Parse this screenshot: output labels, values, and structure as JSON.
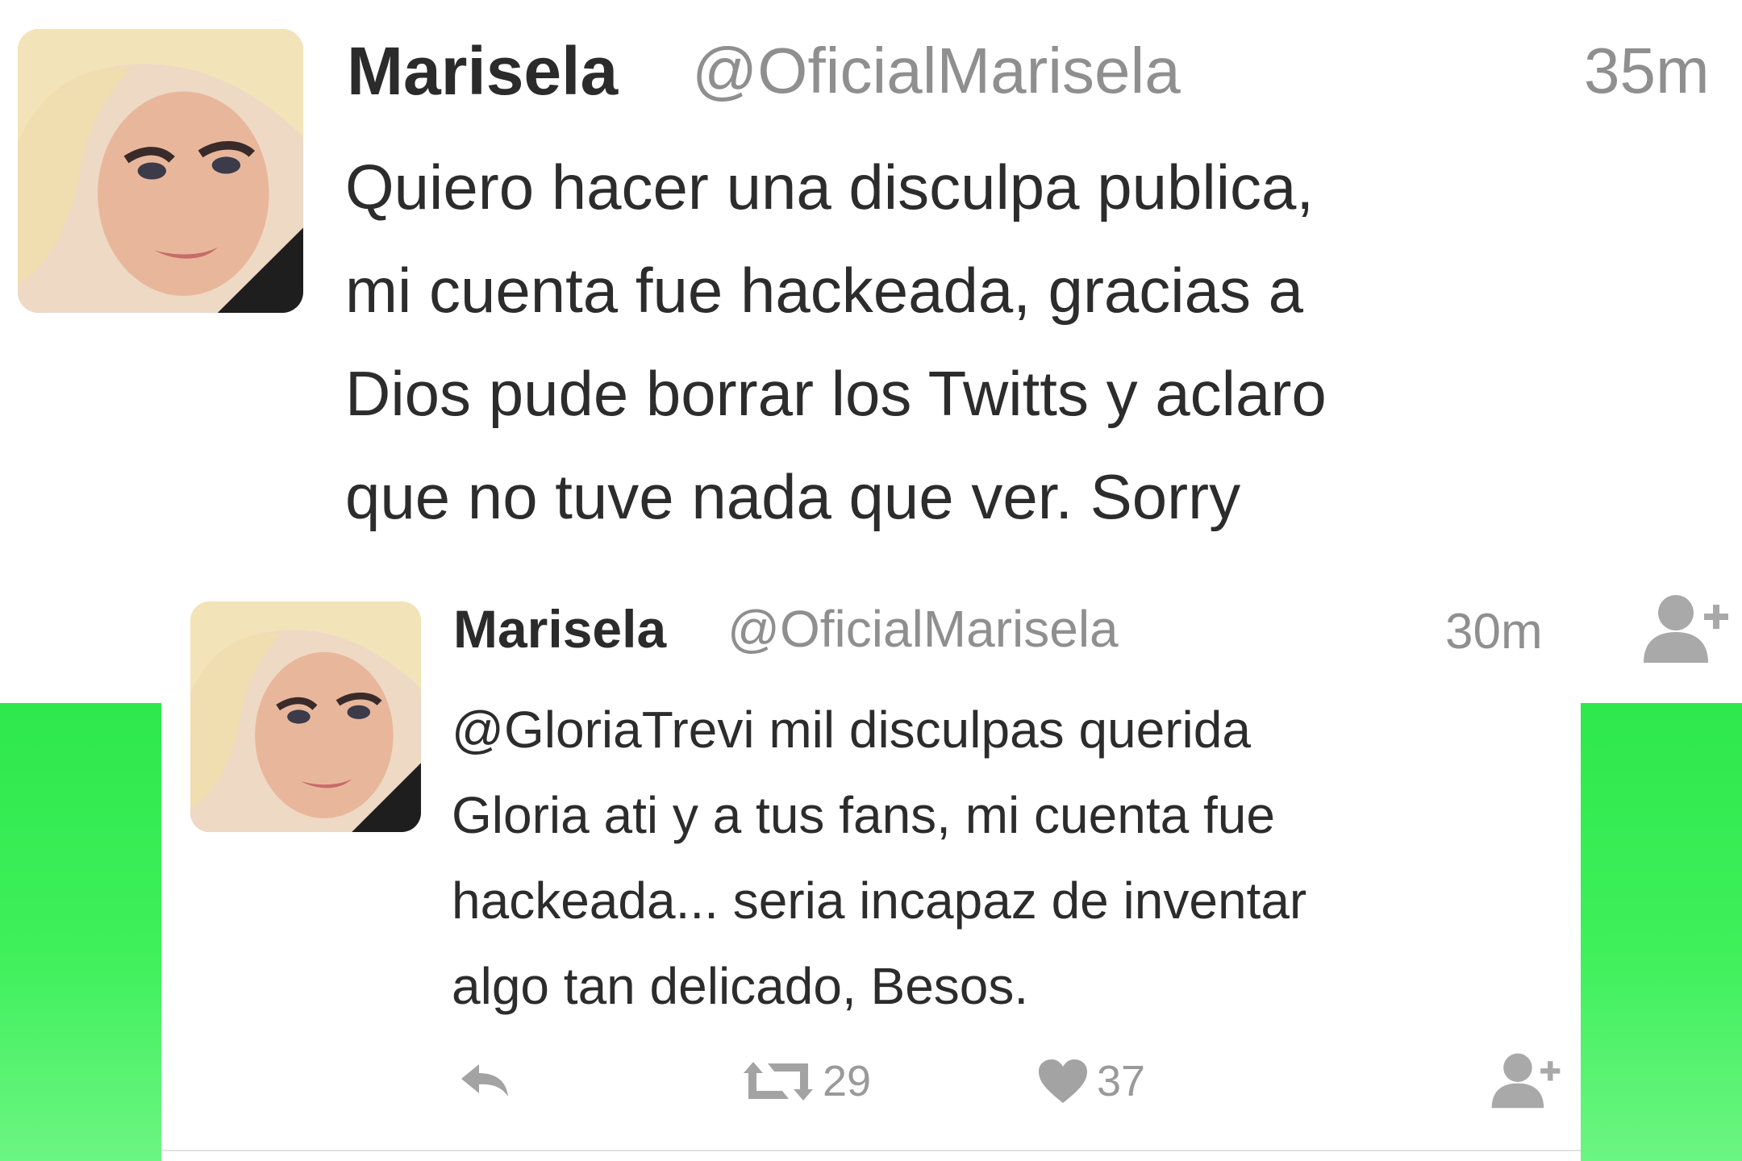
{
  "tweets": [
    {
      "name": "Marisela",
      "handle": "@OficialMarisela",
      "time": "35m",
      "lines": [
        "Quiero hacer una disculpa publica,",
        "mi cuenta fue hackeada, gracias a",
        "Dios pude borrar los Twitts y aclaro",
        "que no tuve nada que ver. Sorry"
      ]
    },
    {
      "name": "Marisela",
      "handle": "@OficialMarisela",
      "time": "30m",
      "lines": [
        "@GloriaTrevi  mil disculpas querida",
        "Gloria ati y a tus fans, mi cuenta fue",
        "hackeada... seria incapaz de inventar",
        "algo tan delicado, Besos."
      ],
      "actions": {
        "retweets": "29",
        "likes": "37"
      }
    }
  ],
  "icons": {
    "avatar": "profile-photo",
    "follow": "add-user-icon",
    "reply": "reply-arrow-icon",
    "retweet": "retweet-icon",
    "like": "heart-icon"
  },
  "colors": {
    "background": "#ffffff",
    "text": "#2c2c2c",
    "muted": "#8f8f8f",
    "green_panel": "#3ff05b"
  }
}
